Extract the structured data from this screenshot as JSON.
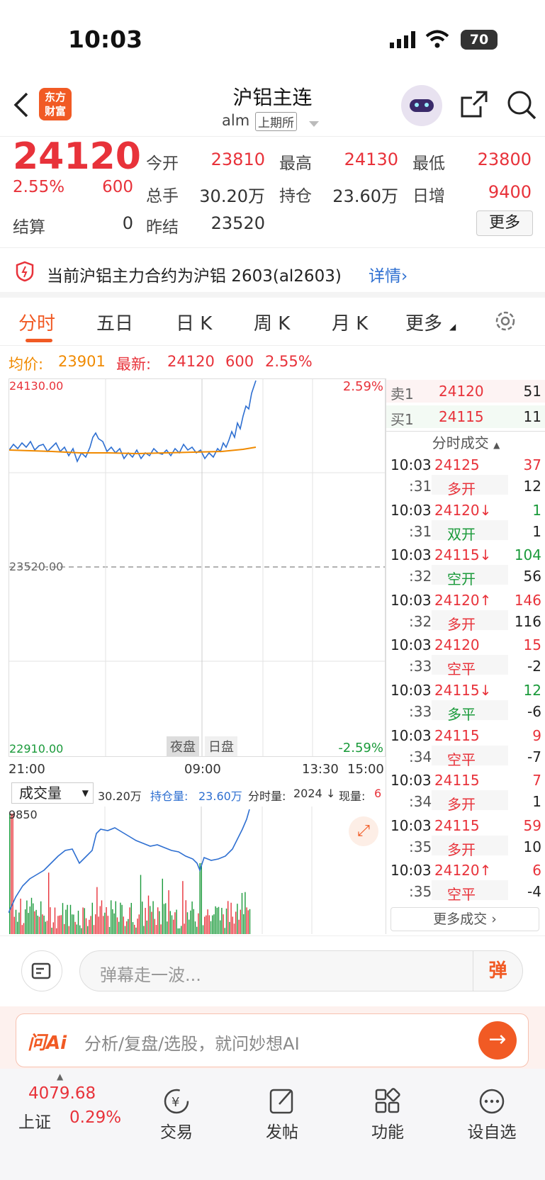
{
  "status": {
    "time": "10:03",
    "battery": "70"
  },
  "header": {
    "title": "沪铝主连",
    "code": "alm",
    "exchange": "上期所",
    "logo_line1": "东方",
    "logo_line2": "财富"
  },
  "quote": {
    "price": "24120",
    "change_pct": "2.55%",
    "change": "600",
    "open_label": "今开",
    "open": "23810",
    "high_label": "最高",
    "high": "24130",
    "low_label": "最低",
    "low": "23800",
    "vol_label": "总手",
    "vol": "30.20万",
    "oi_label": "持仓",
    "oi": "23.60万",
    "daily_label": "日增",
    "daily": "9400",
    "settle_label": "结算",
    "settle": "0",
    "prev_label": "昨结",
    "prev": "23520",
    "more": "更多"
  },
  "notice": {
    "text": "当前沪铝主力合约为沪铝 2603(al2603)",
    "link": "详情"
  },
  "tabs": [
    "分时",
    "五日",
    "日 K",
    "周 K",
    "月 K",
    "更多"
  ],
  "infoline": {
    "avg_label": "均价:",
    "avg": "23901",
    "latest_label": "最新:",
    "latest": "24120",
    "chg": "600",
    "pct": "2.55%"
  },
  "chart": {
    "y_top": "24130.00",
    "y_mid": "23520.00",
    "y_bot": "22910.00",
    "pct_top": "2.59%",
    "pct_bot": "-2.59%",
    "night": "夜盘",
    "day": "日盘",
    "x_labels": [
      "21:00",
      "09:00",
      "13:30",
      "15:00"
    ]
  },
  "vol_header": {
    "select": "成交量",
    "vol": "30.20万",
    "oi_label": "持仓量:",
    "oi": "23.60万",
    "fen_label": "分时量:",
    "fen": "2024",
    "arrow": "↓",
    "cur_label": "现量:",
    "cur": "6",
    "max": "9850"
  },
  "orderbook": {
    "sell_label": "卖1",
    "sell_price": "24120",
    "sell_vol": "51",
    "buy_label": "买1",
    "buy_price": "24115",
    "buy_vol": "11",
    "ticks_title": "分时成交",
    "more_trades": "更多成交"
  },
  "ticks": [
    {
      "t": "10:03",
      "p": "24125",
      "v": "37",
      "s": ":31",
      "k": "多开",
      "n": "12",
      "pc": "red",
      "kc": "red"
    },
    {
      "t": "10:03",
      "p": "24120↓",
      "v": "1",
      "s": ":31",
      "k": "双开",
      "n": "1",
      "pc": "red",
      "vc": "green",
      "kc": "green"
    },
    {
      "t": "10:03",
      "p": "24115↓",
      "v": "104",
      "s": ":32",
      "k": "空开",
      "n": "56",
      "pc": "red",
      "vc": "green",
      "kc": "green"
    },
    {
      "t": "10:03",
      "p": "24120↑",
      "v": "146",
      "s": ":32",
      "k": "多开",
      "n": "116",
      "pc": "red",
      "kc": "red"
    },
    {
      "t": "10:03",
      "p": "24120",
      "v": "15",
      "s": ":33",
      "k": "空平",
      "n": "-2",
      "pc": "red",
      "kc": "red"
    },
    {
      "t": "10:03",
      "p": "24115↓",
      "v": "12",
      "s": ":33",
      "k": "多平",
      "n": "-6",
      "pc": "red",
      "vc": "green",
      "kc": "green"
    },
    {
      "t": "10:03",
      "p": "24115",
      "v": "9",
      "s": ":34",
      "k": "空平",
      "n": "-7",
      "pc": "red",
      "kc": "red"
    },
    {
      "t": "10:03",
      "p": "24115",
      "v": "7",
      "s": ":34",
      "k": "多开",
      "n": "1",
      "pc": "red",
      "kc": "red"
    },
    {
      "t": "10:03",
      "p": "24115",
      "v": "59",
      "s": ":35",
      "k": "多开",
      "n": "10",
      "pc": "red",
      "kc": "red"
    },
    {
      "t": "10:03",
      "p": "24120↑",
      "v": "6",
      "s": ":35",
      "k": "空平",
      "n": "-4",
      "pc": "red",
      "kc": "red"
    }
  ],
  "comment": {
    "placeholder": "弹幕走一波...",
    "send": "弹"
  },
  "ai": {
    "brand": "问Ai",
    "placeholder": "分析/复盘/选股，就问妙想AI"
  },
  "bottom": {
    "index_val": "4079.68",
    "index_name": "上证",
    "index_pct": "0.29%",
    "items": [
      "交易",
      "发帖",
      "功能",
      "设自选"
    ]
  },
  "colors": {
    "up": "#e8323a",
    "down": "#1a9a3a",
    "avg": "#f08a00",
    "price_line": "#2e6fd1"
  }
}
